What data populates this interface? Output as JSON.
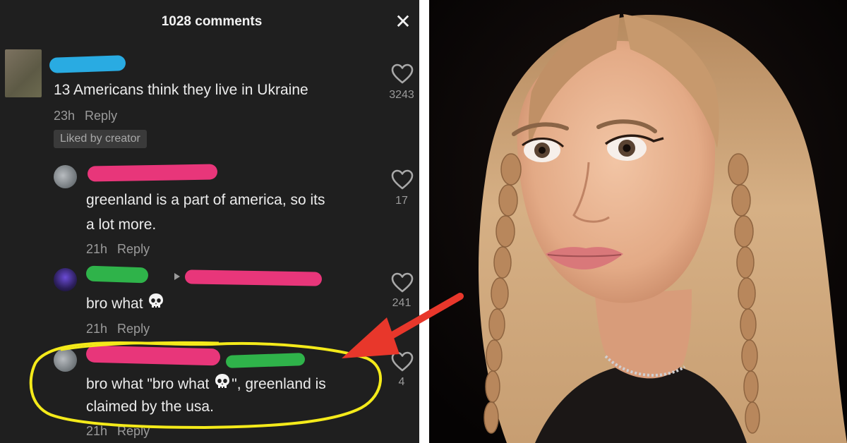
{
  "header": {
    "comment_count": "1028 comments",
    "close_symbol": "✕"
  },
  "comments": [
    {
      "text": "13 Americans think they live in Ukraine",
      "time": "23h",
      "reply_label": "Reply",
      "badge": "Liked by creator",
      "likes": "3243",
      "redaction_color": "#29abe2"
    },
    {
      "text_lines": [
        "greenland is a part of america, so its",
        "a lot more."
      ],
      "time": "21h",
      "reply_label": "Reply",
      "likes": "17",
      "redaction_color": "#e8367a"
    },
    {
      "text": "bro what",
      "time": "21h",
      "reply_label": "Reply",
      "likes": "241",
      "redaction_colors": [
        "#2fb34a",
        "#e8367a"
      ]
    },
    {
      "text_prefix": "bro what \"bro what",
      "text_suffix": "\", greenland is",
      "text_line2": "claimed by the usa.",
      "time": "21h",
      "reply_label": "Reply",
      "likes": "4",
      "redaction_colors": [
        "#e8367a",
        "#2fb34a"
      ]
    }
  ],
  "annotations": {
    "highlight_color": "#f4ea1a",
    "arrow_color": "#e8372b"
  },
  "icons": {
    "like": "heart-outline-icon",
    "emoji": "skull-emoji-icon",
    "close": "close-icon"
  }
}
